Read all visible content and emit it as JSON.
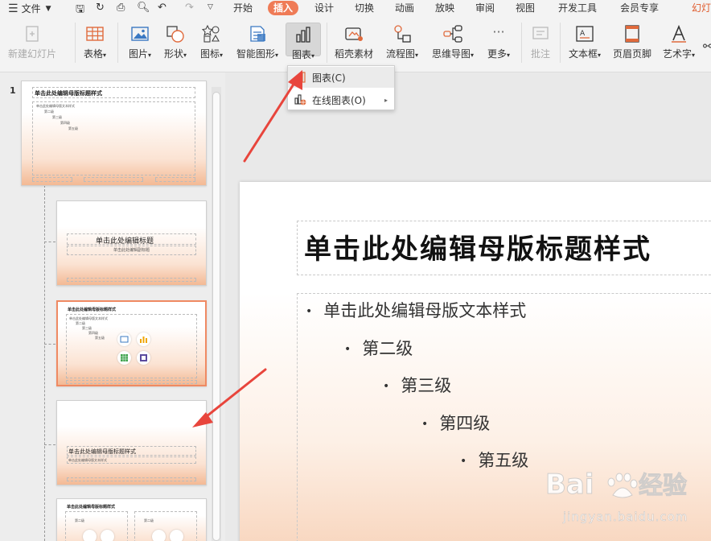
{
  "menubar": {
    "menu_label": "文件",
    "tabs": [
      "开始",
      "插入",
      "设计",
      "切换",
      "动画",
      "放映",
      "审阅",
      "视图",
      "开发工具",
      "会员专享",
      "幻灯"
    ],
    "active_tab": "插入"
  },
  "ribbon": {
    "buttons": [
      {
        "label": "新建幻灯片",
        "icon": "new-slide-icon",
        "disabled": true
      },
      {
        "label": "表格",
        "icon": "table-icon"
      },
      {
        "label": "图片",
        "icon": "picture-icon"
      },
      {
        "label": "形状",
        "icon": "shapes-icon"
      },
      {
        "label": "图标",
        "icon": "icons-icon"
      },
      {
        "label": "智能图形",
        "icon": "smartart-icon"
      },
      {
        "label": "图表",
        "icon": "chart-icon"
      },
      {
        "label": "稻壳素材",
        "icon": "docer-material-icon"
      },
      {
        "label": "流程图",
        "icon": "flowchart-icon"
      },
      {
        "label": "思维导图",
        "icon": "mindmap-icon"
      },
      {
        "label": "更多",
        "icon": "more-icon"
      },
      {
        "label": "批注",
        "icon": "comment-icon",
        "disabled": true
      },
      {
        "label": "文本框",
        "icon": "textbox-icon"
      },
      {
        "label": "页眉页脚",
        "icon": "header-footer-icon"
      },
      {
        "label": "艺术字",
        "icon": "wordart-icon"
      }
    ]
  },
  "dropdown": {
    "items": [
      {
        "label": "图表(C)",
        "icon": "chart-icon"
      },
      {
        "label": "在线图表(O)",
        "icon": "online-chart-icon"
      }
    ]
  },
  "thumbnails": {
    "slide_number": "1",
    "master_title": "单击此处编辑母版标题样式",
    "master_text": "单击此处编辑母版文本样式",
    "level2": "第二级",
    "level3": "第三级",
    "level4": "第四级",
    "level5": "第五级",
    "layout_title": "单击此处编辑标题",
    "layout_subtitle": "单击此处编辑副标题",
    "section_title": "单击此处编辑母版标题样式",
    "section_text": "单击此处编辑母版文本样式"
  },
  "slide": {
    "title": "单击此处编辑母版标题样式",
    "bullets": [
      "单击此处编辑母版文本样式",
      "第二级",
      "第三级",
      "第四级",
      "第五级"
    ]
  },
  "watermark": {
    "brand": "Baidu经验",
    "url": "jingyan.baidu.com"
  },
  "colors": {
    "accent": "#ef7b56",
    "arrow": "#e8453c"
  }
}
